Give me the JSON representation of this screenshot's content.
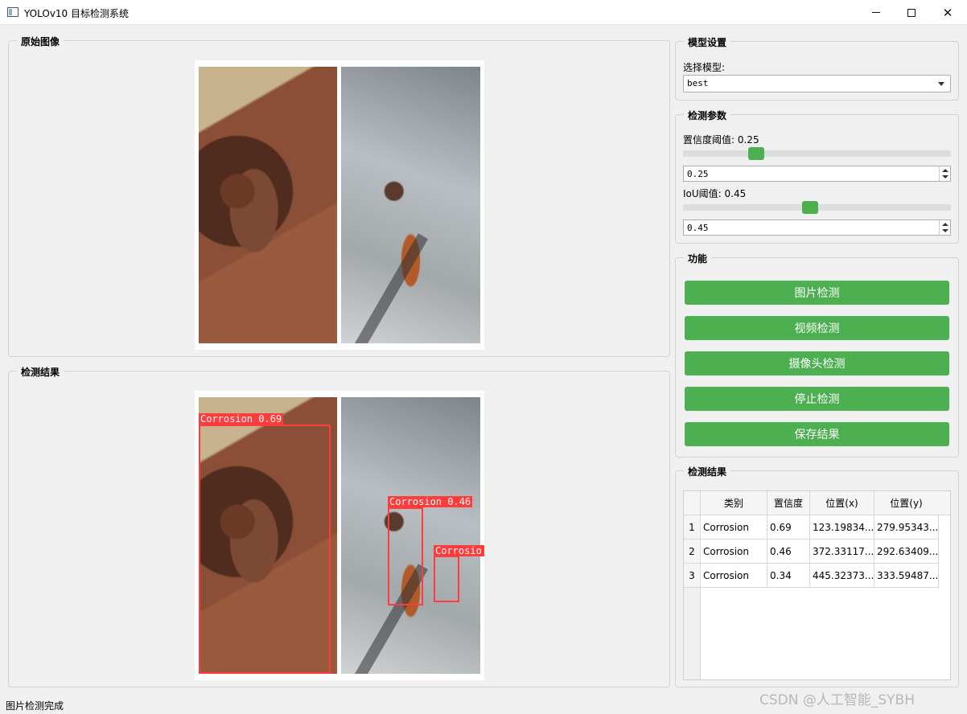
{
  "window": {
    "title": "YOLOv10 目标检测系统",
    "controls": [
      "minimize",
      "maximize",
      "close"
    ]
  },
  "original_panel": {
    "title": "原始图像"
  },
  "result_panel": {
    "title": "检测结果",
    "detections": [
      {
        "label": "Corrosion 0.69"
      },
      {
        "label": "Corrosion 0.46"
      },
      {
        "label": "Corrosio"
      }
    ]
  },
  "model_settings": {
    "title": "模型设置",
    "select_label": "选择模型:",
    "selected_model": "best"
  },
  "params": {
    "title": "检测参数",
    "conf_label": "置信度阈值: 0.25",
    "conf_value": "0.25",
    "conf_fraction": 0.25,
    "iou_label": "IoU阈值: 0.45",
    "iou_value": "0.45",
    "iou_fraction": 0.45
  },
  "functions": {
    "title": "功能",
    "buttons": [
      "图片检测",
      "视频检测",
      "摄像头检测",
      "停止检测",
      "保存结果"
    ],
    "button_color": "#4caf50"
  },
  "results_table": {
    "title": "检测结果",
    "headers": [
      "类别",
      "置信度",
      "位置(x)",
      "位置(y)"
    ],
    "rows": [
      {
        "index": "1",
        "cls": "Corrosion",
        "conf": "0.69",
        "x": "123.19834...",
        "y": "279.95343..."
      },
      {
        "index": "2",
        "cls": "Corrosion",
        "conf": "0.46",
        "x": "372.33117...",
        "y": "292.63409..."
      },
      {
        "index": "3",
        "cls": "Corrosion",
        "conf": "0.34",
        "x": "445.32373...",
        "y": "333.59487..."
      }
    ]
  },
  "status_bar": {
    "text": "图片检测完成"
  },
  "watermark": "CSDN @人工智能_SYBH",
  "icons": {
    "app": "window-icon",
    "dropdown": "chevron-down-icon",
    "spin_up": "arrow-up-icon",
    "spin_down": "arrow-down-icon"
  },
  "colors": {
    "accent": "#4caf50",
    "bbox": "#ff3b3b"
  }
}
